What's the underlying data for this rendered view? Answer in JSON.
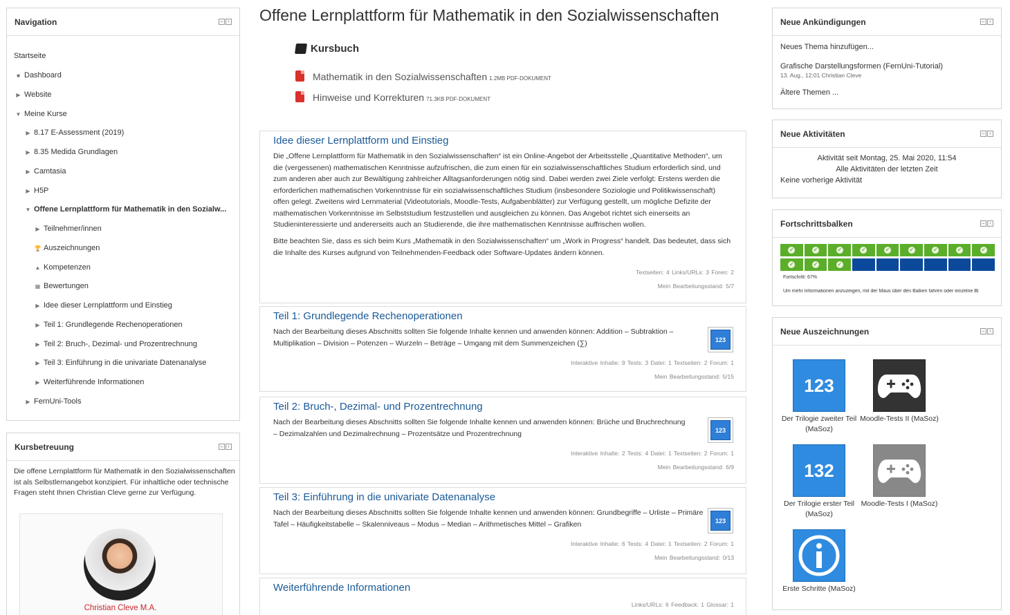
{
  "navigation": {
    "title": "Navigation",
    "items": [
      {
        "label": "Startseite"
      },
      {
        "label": "Dashboard"
      },
      {
        "label": "Website"
      },
      {
        "label": "Meine Kurse"
      },
      {
        "label": "8.17 E-Assessment (2019)"
      },
      {
        "label": "8.35 Medida Grundlagen"
      },
      {
        "label": "Camtasia"
      },
      {
        "label": "H5P"
      },
      {
        "label": "Offene Lernplattform für Mathematik in den Sozialw..."
      },
      {
        "label": "Teilnehmer/innen"
      },
      {
        "label": "Auszeichnungen"
      },
      {
        "label": "Kompetenzen"
      },
      {
        "label": "Bewertungen"
      },
      {
        "label": "Idee dieser Lernplattform und Einstieg"
      },
      {
        "label": "Teil 1: Grundlegende Rechenoperationen"
      },
      {
        "label": "Teil 2: Bruch-, Dezimal- und Prozentrechnung"
      },
      {
        "label": "Teil 3: Einführung in die univariate Datenanalyse"
      },
      {
        "label": "Weiterführende Informationen"
      },
      {
        "label": "FernUni-Tools"
      }
    ]
  },
  "kursbetreuung": {
    "title": "Kursbetreuung",
    "text": "Die offene Lernplattform für Mathematik in den Sozialwissenschaften ist als Selbstlernangebot konzipiert. Für inhaltliche oder technische Fragen steht Ihnen Christian Cleve gerne zur Verfügung.",
    "name": "Christian Cleve M.A."
  },
  "main": {
    "title": "Offene Lernplattform für Mathematik in den Sozialwissenschaften",
    "kursbuch": "Kursbuch",
    "files": [
      {
        "name": "Mathematik in den Sozialwissenschaften",
        "size": "1.2MB PDF-Dokument"
      },
      {
        "name": "Hinweise und Korrekturen",
        "size": "71.3KB PDF-Dokument"
      }
    ],
    "sections": [
      {
        "title": "Idee dieser Lernplattform und Einstieg",
        "text1": "Die „Offene Lernplattform für Mathematik in den Sozialwissenschaften“ ist ein Online-Angebot der Arbeitsstelle „Quantitative Methoden“, um die (vergessenen) mathematischen Kenntnisse aufzufrischen, die zum einen für ein sozialwissenschaftliches Studium erforderlich sind, und zum anderen aber auch zur Bewältigung zahlreicher Alltagsanforderungen nötig sind. Dabei werden zwei Ziele verfolgt: Erstens werden die erforderlichen mathematischen Vorkenntnisse für ein sozialwissenschaftliches Studium (insbesondere Soziologie und Politikwissenschaft) offen gelegt. Zweitens wird Lernmaterial (Videotutorials, Moodle-Tests, Aufgabenblätter) zur Verfügung gestellt, um mögliche Defizite der mathematischen Vorkenntnisse im Selbststudium festzustellen und ausgleichen zu können. Das Angebot richtet sich einerseits an Studieninteressierte und andererseits auch an Studierende, die ihre mathematischen Kenntnisse auffrischen wollen.",
        "text2": "Bitte beachten Sie, dass es sich beim Kurs „Mathematik in den Sozialwissenschaften“ um „Work in Progress“ handelt. Das bedeutet, dass sich die Inhalte des Kurses aufgrund von Teilnehmenden-Feedback oder Software-Updates ändern können.",
        "meta": "Textseiten: 4  Links/URLs: 3  Foren: 2",
        "status": "Mein Bearbeitungsstand: 5/7"
      },
      {
        "title": "Teil 1: Grundlegende Rechenoperationen",
        "text1": "Nach der Bearbeitung dieses Abschnitts sollten Sie folgende Inhalte kennen und anwenden können: Addition – Subtraktion – Multiplikation – Division – Potenzen – Wurzeln – Beträge – Umgang mit dem Summenzeichen (∑)",
        "meta": "Interaktive Inhalte: 9  Tests: 3  Datei: 1  Textseiten: 2  Forum: 1",
        "status": "Mein Bearbeitungsstand: 5/15"
      },
      {
        "title": "Teil 2: Bruch-, Dezimal- und Prozentrechnung",
        "text1": "Nach der Bearbeitung dieses Abschnitts sollten Sie folgende Inhalte kennen und anwenden können: Brüche und Bruchrechnung – Dezimalzahlen und Dezimalrechnung – Prozentsätze und Prozentrechnung",
        "meta": "Interaktive Inhalte: 2  Tests: 4  Datei: 1  Textseiten: 2  Forum: 1",
        "status": "Mein Bearbeitungsstand: 6/9"
      },
      {
        "title": "Teil 3: Einführung in die univariate Datenanalyse",
        "text1": "Nach der Bearbeitung dieses Abschnitts sollten Sie folgende Inhalte kennen und anwenden können: Grundbegriffe – Urliste – Primäre Tafel – Häufigkeitstabelle – Skalenniveaus – Modus – Median – Arithmetisches Mittel – Grafiken",
        "meta": "Interaktive Inhalte: 6  Tests: 4  Datei: 1  Textseiten: 2  Forum: 1",
        "status": "Mein Bearbeitungsstand: 0/13"
      },
      {
        "title": "Weiterführende Informationen",
        "meta": "Links/URLs: 6  Feedback: 1  Glossar: 1"
      }
    ]
  },
  "ankuendigungen": {
    "title": "Neue Ankündigungen",
    "add": "Neues Thema hinzufügen...",
    "post_title": "Grafische Darstellungsformen (FernUni-Tutorial)",
    "post_meta": "13. Aug., 12:01  Christian Cleve",
    "older": "Ältere Themen ..."
  },
  "aktivitaeten": {
    "title": "Neue Aktivitäten",
    "since": "Aktivität seit Montag, 25. Mai 2020, 11:54",
    "all": "Alle Aktivitäten der letzten Zeit",
    "none": "Keine vorherige Aktivität"
  },
  "fortschritt": {
    "title": "Fortschrittsbalken",
    "completed": 12,
    "total": 18,
    "label": "Fortschritt: 67%",
    "hint": "Um mehr Informationen anzuzeigen, mit der Maus über den Balken fahren oder einzelne Bl"
  },
  "auszeichnungen": {
    "title": "Neue Auszeichnungen",
    "badges": [
      {
        "label": "Der Trilogie zweiter Teil (MaSoz)",
        "icon": "dice-icon"
      },
      {
        "label": "Moodle-Tests II (MaSoz)",
        "icon": "gamepad-icon"
      },
      {
        "label": "Der Trilogie erster Teil (MaSoz)",
        "icon": "dice-icon"
      },
      {
        "label": "Moodle-Tests I (MaSoz)",
        "icon": "gamepad-icon"
      },
      {
        "label": "Erste Schritte (MaSoz)",
        "icon": "info-icon"
      }
    ]
  },
  "colors": {
    "link": "#1a5a98",
    "progress_done": "#5bae2a",
    "progress_todo": "#0b4a9a",
    "badge_blue": "#2f8be0"
  }
}
